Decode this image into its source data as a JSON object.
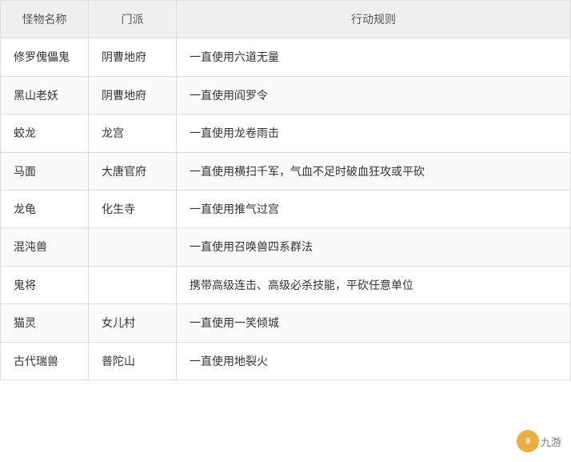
{
  "table": {
    "headers": [
      "怪物名称",
      "门派",
      "行动规则"
    ],
    "rows": [
      {
        "name": "修罗傀儡鬼",
        "faction": "阴曹地府",
        "rule": "一直使用六道无量"
      },
      {
        "name": "黑山老妖",
        "faction": "阴曹地府",
        "rule": "一直使用阎罗令"
      },
      {
        "name": "蛟龙",
        "faction": "龙宫",
        "rule": "一直使用龙卷雨击"
      },
      {
        "name": "马面",
        "faction": "大唐官府",
        "rule": "一直使用横扫千军，气血不足时破血狂攻或平砍"
      },
      {
        "name": "龙龟",
        "faction": "化生寺",
        "rule": "一直使用推气过宫"
      },
      {
        "name": "混沌兽",
        "faction": "",
        "rule": "一直使用召唤兽四系群法"
      },
      {
        "name": "鬼将",
        "faction": "",
        "rule": "携带高级连击、高级必杀技能，平砍任意单位"
      },
      {
        "name": "猫灵",
        "faction": "女儿村",
        "rule": "一直使用一笑倾城"
      },
      {
        "name": "古代瑞兽",
        "faction": "普陀山",
        "rule": "一直使用地裂火"
      }
    ]
  },
  "watermark": {
    "logo": "9",
    "text": "九游"
  }
}
